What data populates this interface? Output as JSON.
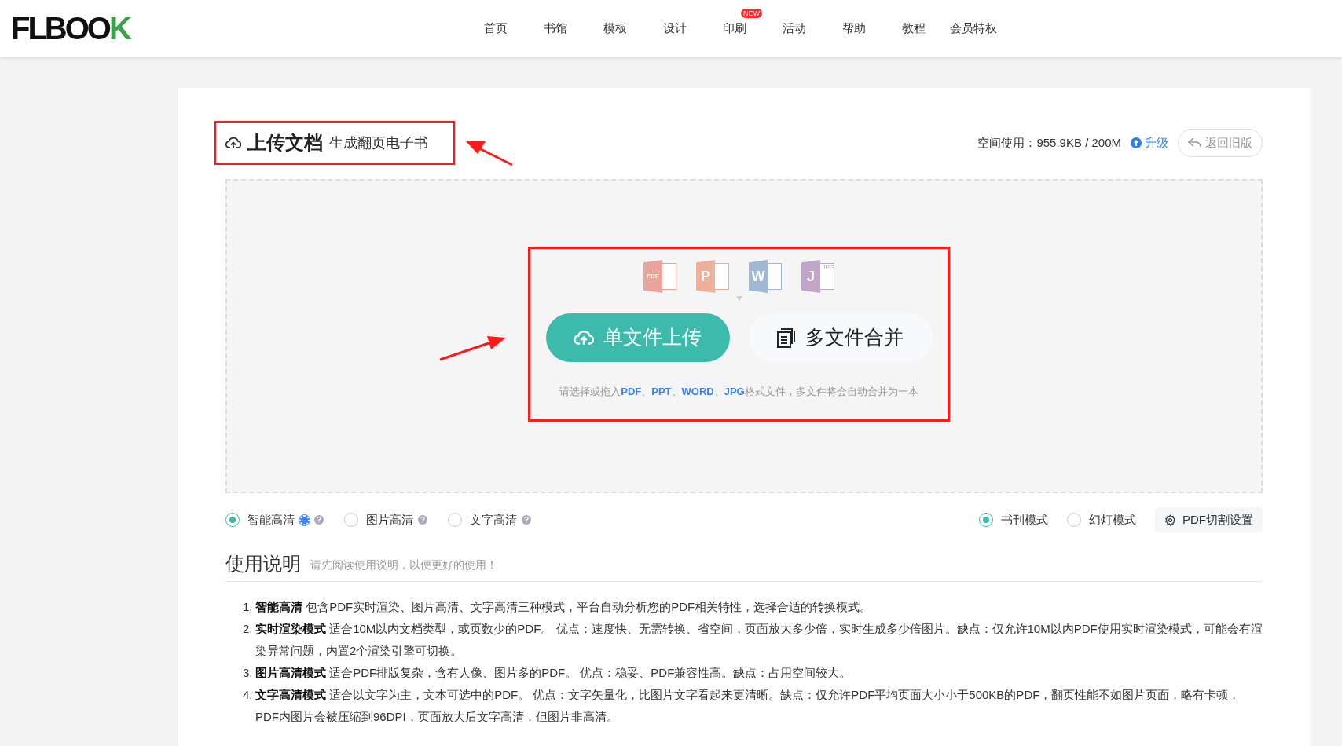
{
  "header": {
    "logo": "FLBOOK",
    "nav": [
      {
        "label": "首页"
      },
      {
        "label": "书馆"
      },
      {
        "label": "模板"
      },
      {
        "label": "设计"
      },
      {
        "label": "印刷",
        "badge": "NEW"
      },
      {
        "label": "活动"
      },
      {
        "label": "帮助"
      },
      {
        "label": "教程"
      },
      {
        "label": "会员特权"
      }
    ]
  },
  "upload_panel": {
    "title": "上传文档",
    "subtitle": "生成翻页电子书",
    "storage": "空间使用：955.9KB / 200M",
    "upgrade_link": "升级",
    "back_button": "返回旧版",
    "file_types": [
      {
        "kind": "pdf",
        "label": "PDF"
      },
      {
        "kind": "ppt",
        "label": "P"
      },
      {
        "kind": "word",
        "label": "W"
      },
      {
        "kind": "jpg",
        "label": "J",
        "tag": "JPG"
      }
    ],
    "buttons": [
      {
        "kind": "primary",
        "label": "单文件上传"
      },
      {
        "kind": "secondary",
        "label": "多文件合并"
      }
    ],
    "hint": "请选择或拖入**PDF**、**PPT**、**WORD**、**JPG**格式文件，多文件将会自动合并为一本"
  },
  "quality_options": [
    {
      "label": "智能高清",
      "selected": true,
      "badge": true
    },
    {
      "label": "图片高清",
      "selected": false,
      "badge": false
    },
    {
      "label": "文字高清",
      "selected": false,
      "badge": false
    }
  ],
  "mode_options": [
    {
      "label": "书刊模式",
      "selected": true
    },
    {
      "label": "幻灯模式",
      "selected": false
    }
  ],
  "split_settings_button": "PDF切割设置",
  "instructions": {
    "title": "使用说明",
    "subtitle": "请先阅读使用说明，以便更好的使用！",
    "items": [
      {
        "number": "1.",
        "text": "**智能高清** 包含PDF实时渲染、图片高清、文字高清三种模式，平台自动分析您的PDF相关特性，选择合适的转换模式。"
      },
      {
        "number": "2.",
        "text": "**实时渲染模式** 适合10M以内文档类型，或页数少的PDF。 优点：速度快、无需转换、省空间，页面放大多少倍，实时生成多少倍图片。缺点：仅允许10M以内PDF使用实时渲染模式，可能会有渲染异常问题，内置2个渲染引擎可切换。"
      },
      {
        "number": "3.",
        "text": "**图片高清模式** 适合PDF排版复杂，含有人像、图片多的PDF。 优点：稳妥、PDF兼容性高。缺点：占用空间较大。"
      },
      {
        "number": "4.",
        "text": "**文字高清模式** 适合以文字为主，文本可选中的PDF。 优点：文字矢量化，比图片文字看起来更清晰。缺点：仅允许PDF平均页面大小小于500KB的PDF，翻页性能不如图片页面，略有卡顿，PDF内图片会被压缩到96DPI，页面放大后文字高清，但图片非高清。"
      }
    ]
  }
}
